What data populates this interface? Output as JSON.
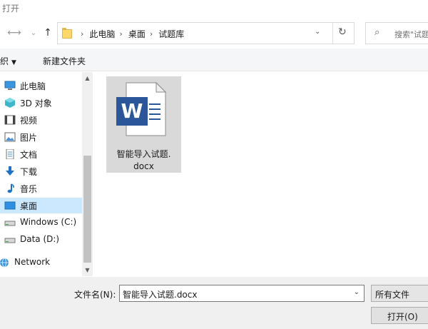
{
  "window": {
    "title": "打开"
  },
  "address": {
    "crumbs": [
      "此电脑",
      "桌面",
      "试题库"
    ],
    "search_placeholder": "搜索\"试题库\""
  },
  "toolbar": {
    "organize": "组织",
    "new_folder": "新建文件夹"
  },
  "sidebar": {
    "items": [
      {
        "label": "此电脑",
        "icon": "computer-icon"
      },
      {
        "label": "3D 对象",
        "icon": "3d-objects-icon"
      },
      {
        "label": "视频",
        "icon": "video-icon"
      },
      {
        "label": "图片",
        "icon": "pictures-icon"
      },
      {
        "label": "文档",
        "icon": "documents-icon"
      },
      {
        "label": "下载",
        "icon": "download-icon"
      },
      {
        "label": "音乐",
        "icon": "music-icon"
      },
      {
        "label": "桌面",
        "icon": "desktop-icon",
        "selected": true
      },
      {
        "label": "Windows (C:)",
        "icon": "drive-icon"
      },
      {
        "label": "Data (D:)",
        "icon": "drive-icon"
      },
      {
        "label": "Network",
        "icon": "network-icon"
      }
    ]
  },
  "files": [
    {
      "name": "智能导入试题.docx",
      "name_line1": "智能导入试题.",
      "name_line2": "docx",
      "icon": "word-document-icon"
    }
  ],
  "footer": {
    "filename_label": "文件名(N):",
    "filename_value": "智能导入试题.docx",
    "filetype_value": "所有文件",
    "open_button": "打开(O)"
  },
  "colors": {
    "selection": "#cce8ff",
    "word_blue": "#2b579a",
    "folder_yellow": "#ffd86b"
  }
}
